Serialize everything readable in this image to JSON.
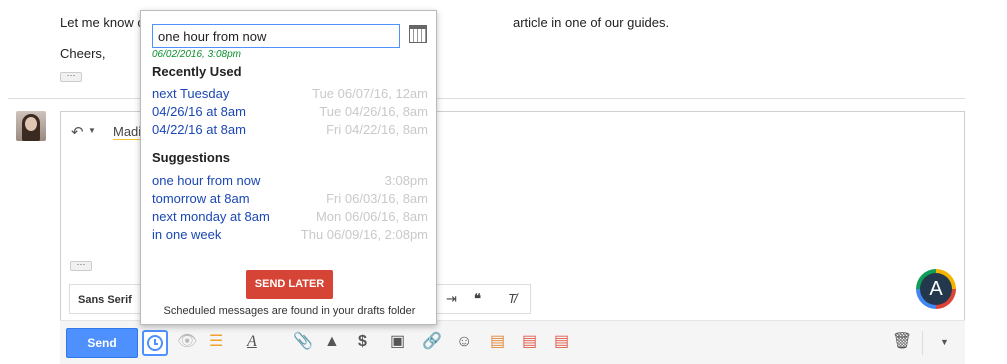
{
  "email": {
    "line1_start": "Let me know c",
    "line1_end": "article in one of our guides.",
    "signoff": "Cheers,",
    "collapse_label": "···"
  },
  "compose": {
    "reply_icon": "reply-icon",
    "to_text": "Madi",
    "collapse_label": "···",
    "font_label": "Sans Serif"
  },
  "extension": {
    "logo_letter": "A"
  },
  "toolbar": {
    "send_label": "Send"
  },
  "send_later_popup": {
    "input_value": "one hour from now",
    "parsed_date": "06/02/2016, 3:08pm",
    "recent_heading": "Recently Used",
    "recent": [
      {
        "label": "next Tuesday",
        "value": "Tue 06/07/16, 12am"
      },
      {
        "label": "04/26/16 at 8am",
        "value": "Tue 04/26/16, 8am"
      },
      {
        "label": "04/22/16 at 8am",
        "value": "Fri 04/22/16, 8am"
      }
    ],
    "suggestions_heading": "Suggestions",
    "suggestions": [
      {
        "label": "one hour from now",
        "value": "3:08pm"
      },
      {
        "label": "tomorrow at 8am",
        "value": "Fri 06/03/16, 8am"
      },
      {
        "label": "next monday at 8am",
        "value": "Mon 06/06/16, 8am"
      },
      {
        "label": "in one week",
        "value": "Thu 06/09/16, 2:08pm"
      }
    ],
    "send_later_label": "SEND LATER",
    "footnote": "Scheduled messages are found in your drafts folder"
  },
  "colors": {
    "send_blue": "#4d90fe",
    "send_later_red": "#d54434",
    "link_blue": "#1a47b4",
    "parsed_green": "#0a8f2c"
  }
}
